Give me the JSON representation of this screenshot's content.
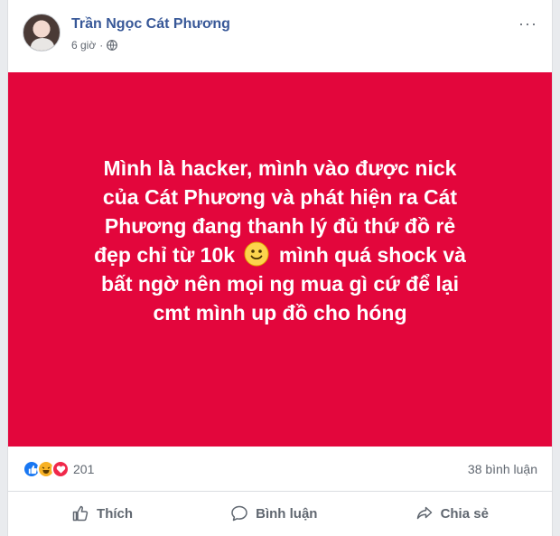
{
  "post": {
    "author": "Trần Ngọc Cát Phương",
    "time": "6 giờ",
    "more": "···",
    "lines": [
      "Mình là hacker, mình vào được nick",
      "của Cát Phương và phát hiện ra Cát",
      "Phương đang thanh lý đủ thứ đồ rẻ",
      "đẹp chỉ từ 10k",
      "mình quá shock và",
      "bất ngờ nên mọi ng mua gì cứ để lại",
      "cmt mình up đồ cho hóng"
    ],
    "background_color": "#e3063c"
  },
  "stats": {
    "reaction_count": "201",
    "comments_count": "38 bình luận"
  },
  "actions": {
    "like": "Thích",
    "comment": "Bình luận",
    "share": "Chia sẻ"
  }
}
